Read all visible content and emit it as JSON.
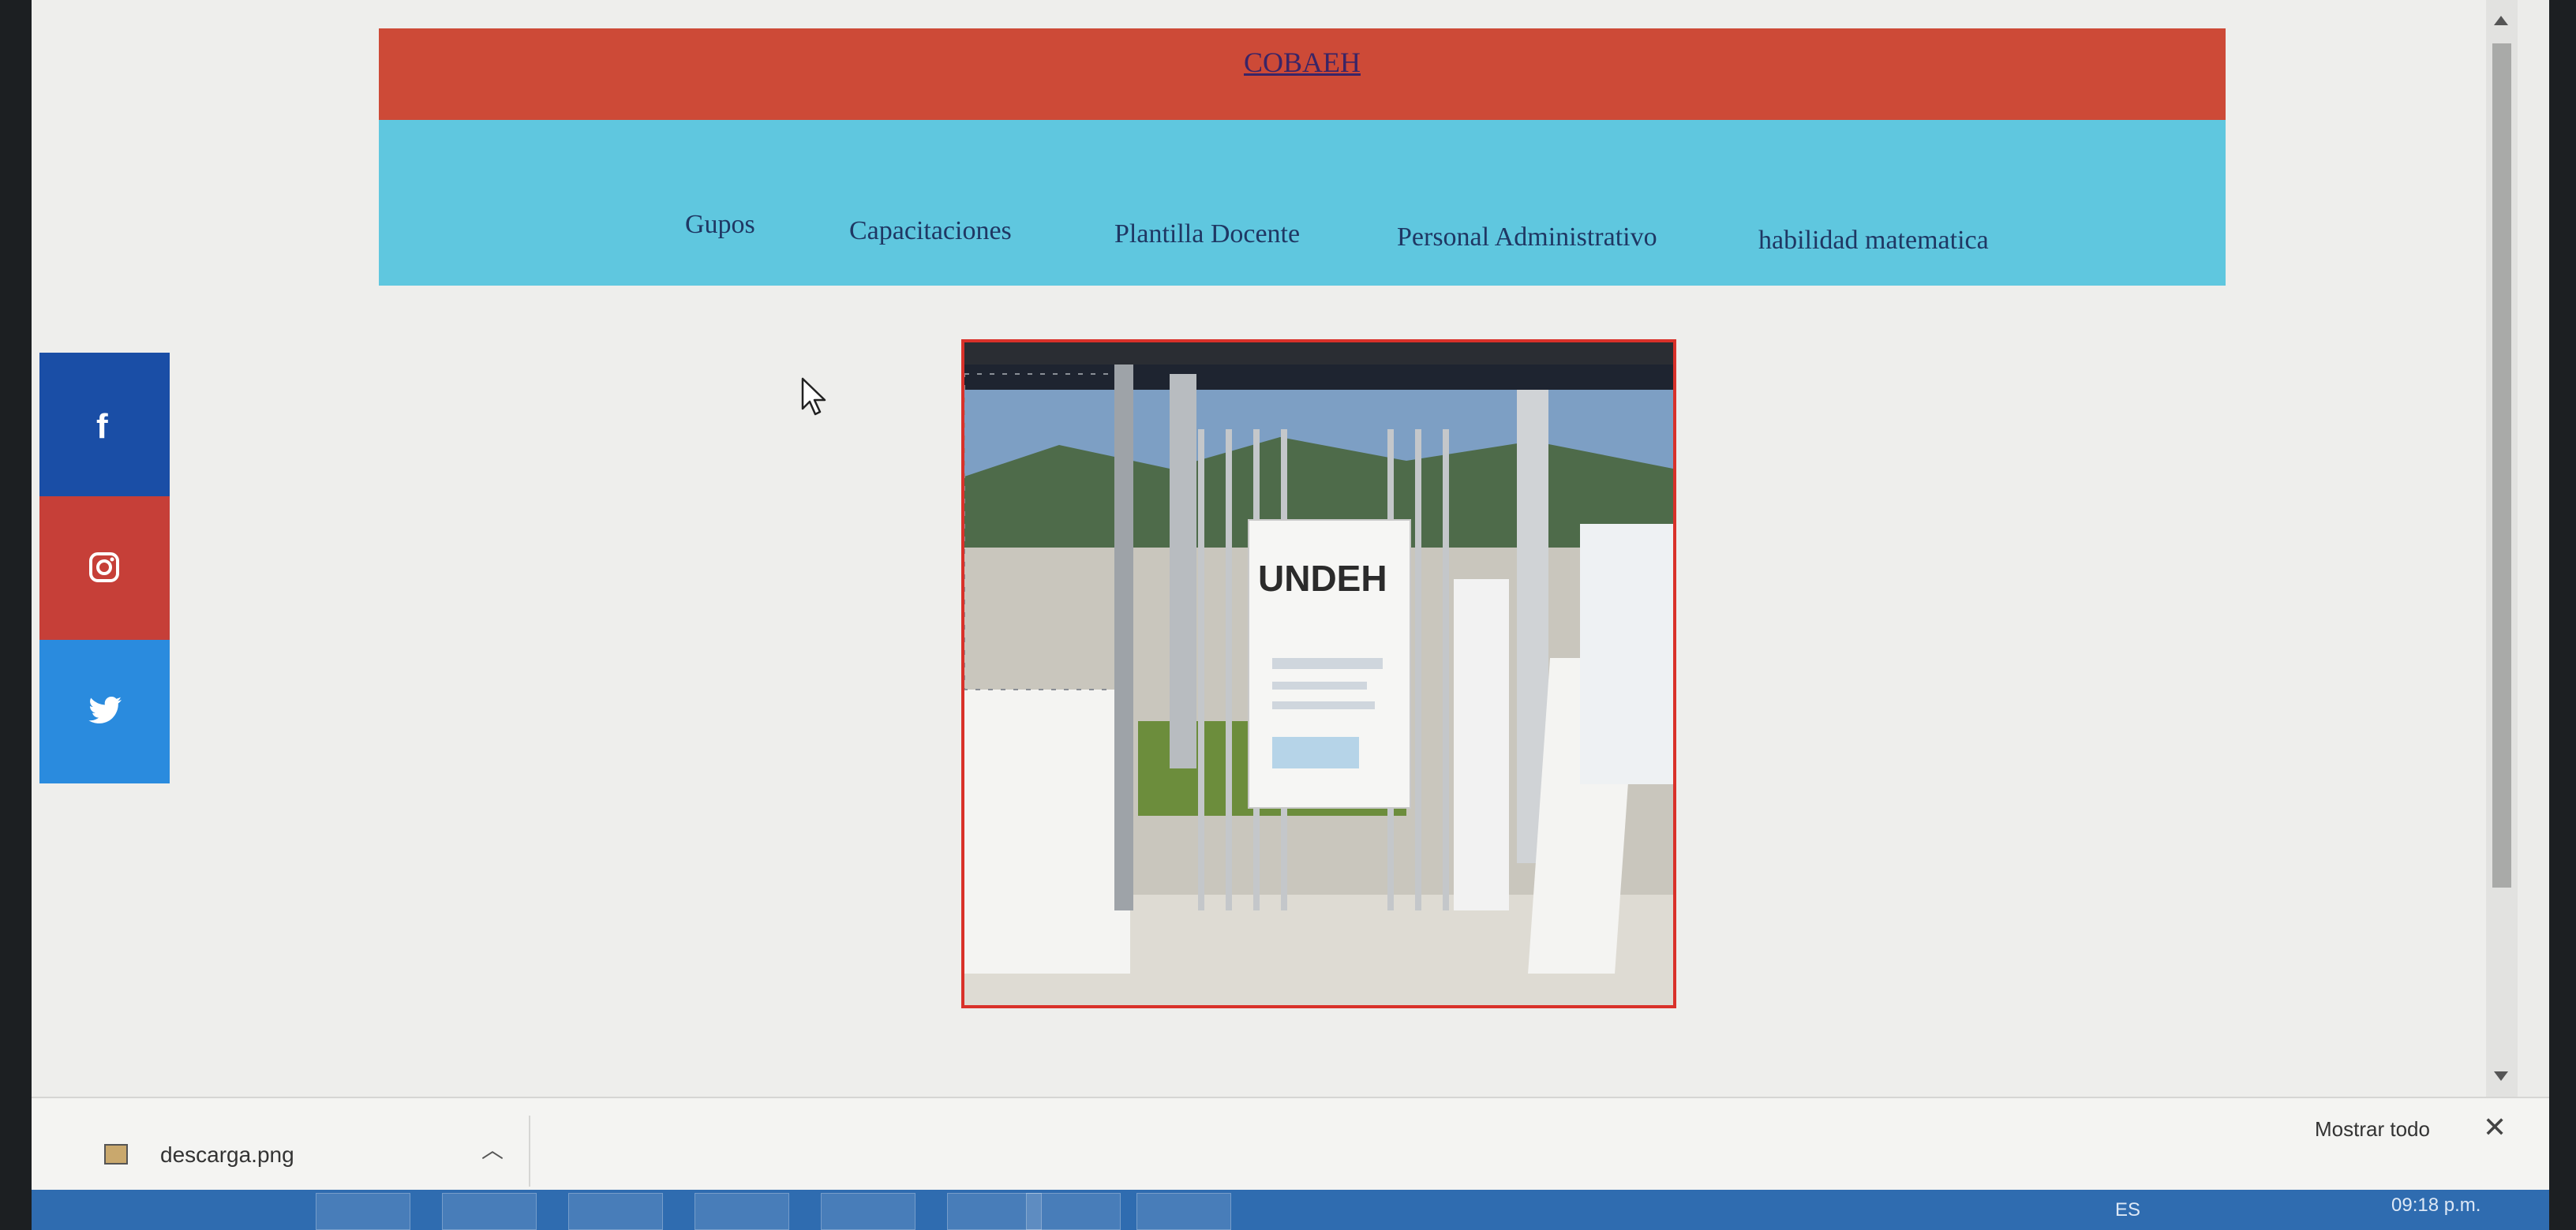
{
  "header": {
    "title": "COBAEH"
  },
  "nav": {
    "items": [
      {
        "label": "Gupos"
      },
      {
        "label": "Capacitaciones"
      },
      {
        "label": "Plantilla Docente"
      },
      {
        "label": "Personal Administrativo"
      },
      {
        "label": "habilidad matematica"
      }
    ]
  },
  "social": {
    "facebook": "f",
    "instagram_icon": "instagram-icon",
    "twitter_icon": "twitter-icon"
  },
  "photo": {
    "poster_text": "UNDEH"
  },
  "downloads": {
    "filename": "descarga.png",
    "show_all": "Mostrar todo",
    "close": "✕"
  },
  "taskbar": {
    "language": "ES",
    "time": "09:18 p.m."
  },
  "colors": {
    "header_red": "#cd4a37",
    "nav_cyan": "#5fc7df",
    "facebook_blue": "#1a4ea6",
    "instagram_red": "#c63f38",
    "twitter_blue": "#2a8bde",
    "photo_border": "#d9312a"
  }
}
